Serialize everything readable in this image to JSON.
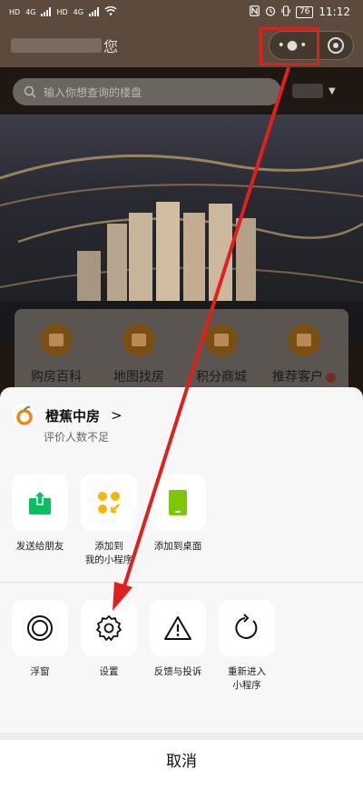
{
  "status_bar": {
    "left_labels": [
      "HD",
      "4G",
      "HD",
      "4G"
    ],
    "battery": "76",
    "time": "11:12"
  },
  "nav": {
    "title_suffix": "您"
  },
  "search": {
    "placeholder": "输入你想查询的楼盘"
  },
  "categories": [
    {
      "label": "购房百科"
    },
    {
      "label": "地图找房"
    },
    {
      "label": "积分商城"
    },
    {
      "label": "推荐客户"
    }
  ],
  "sheet": {
    "app_name": "橙蕉中房",
    "app_chevron": ">",
    "rating_text": "评价人数不足",
    "row1": [
      {
        "label": "发送给朋友",
        "icon": "share-icon"
      },
      {
        "label": "添加到\n我的小程序",
        "icon": "add-to-mini-program-icon"
      },
      {
        "label": "添加到桌面",
        "icon": "add-to-desktop-icon"
      }
    ],
    "row2": [
      {
        "label": "浮窗",
        "icon": "floating-window-icon"
      },
      {
        "label": "设置",
        "icon": "settings-gear-icon"
      },
      {
        "label": "反馈与投诉",
        "icon": "feedback-warning-icon"
      },
      {
        "label": "重新进入\n小程序",
        "icon": "reload-icon"
      }
    ],
    "cancel_label": "取消"
  },
  "colors": {
    "accent_green": "#07c160",
    "accent_yellow": "#f5b800",
    "accent_lime": "#7fc60a",
    "annotation_red": "#e0211b",
    "brand_orange": "#f08519"
  }
}
